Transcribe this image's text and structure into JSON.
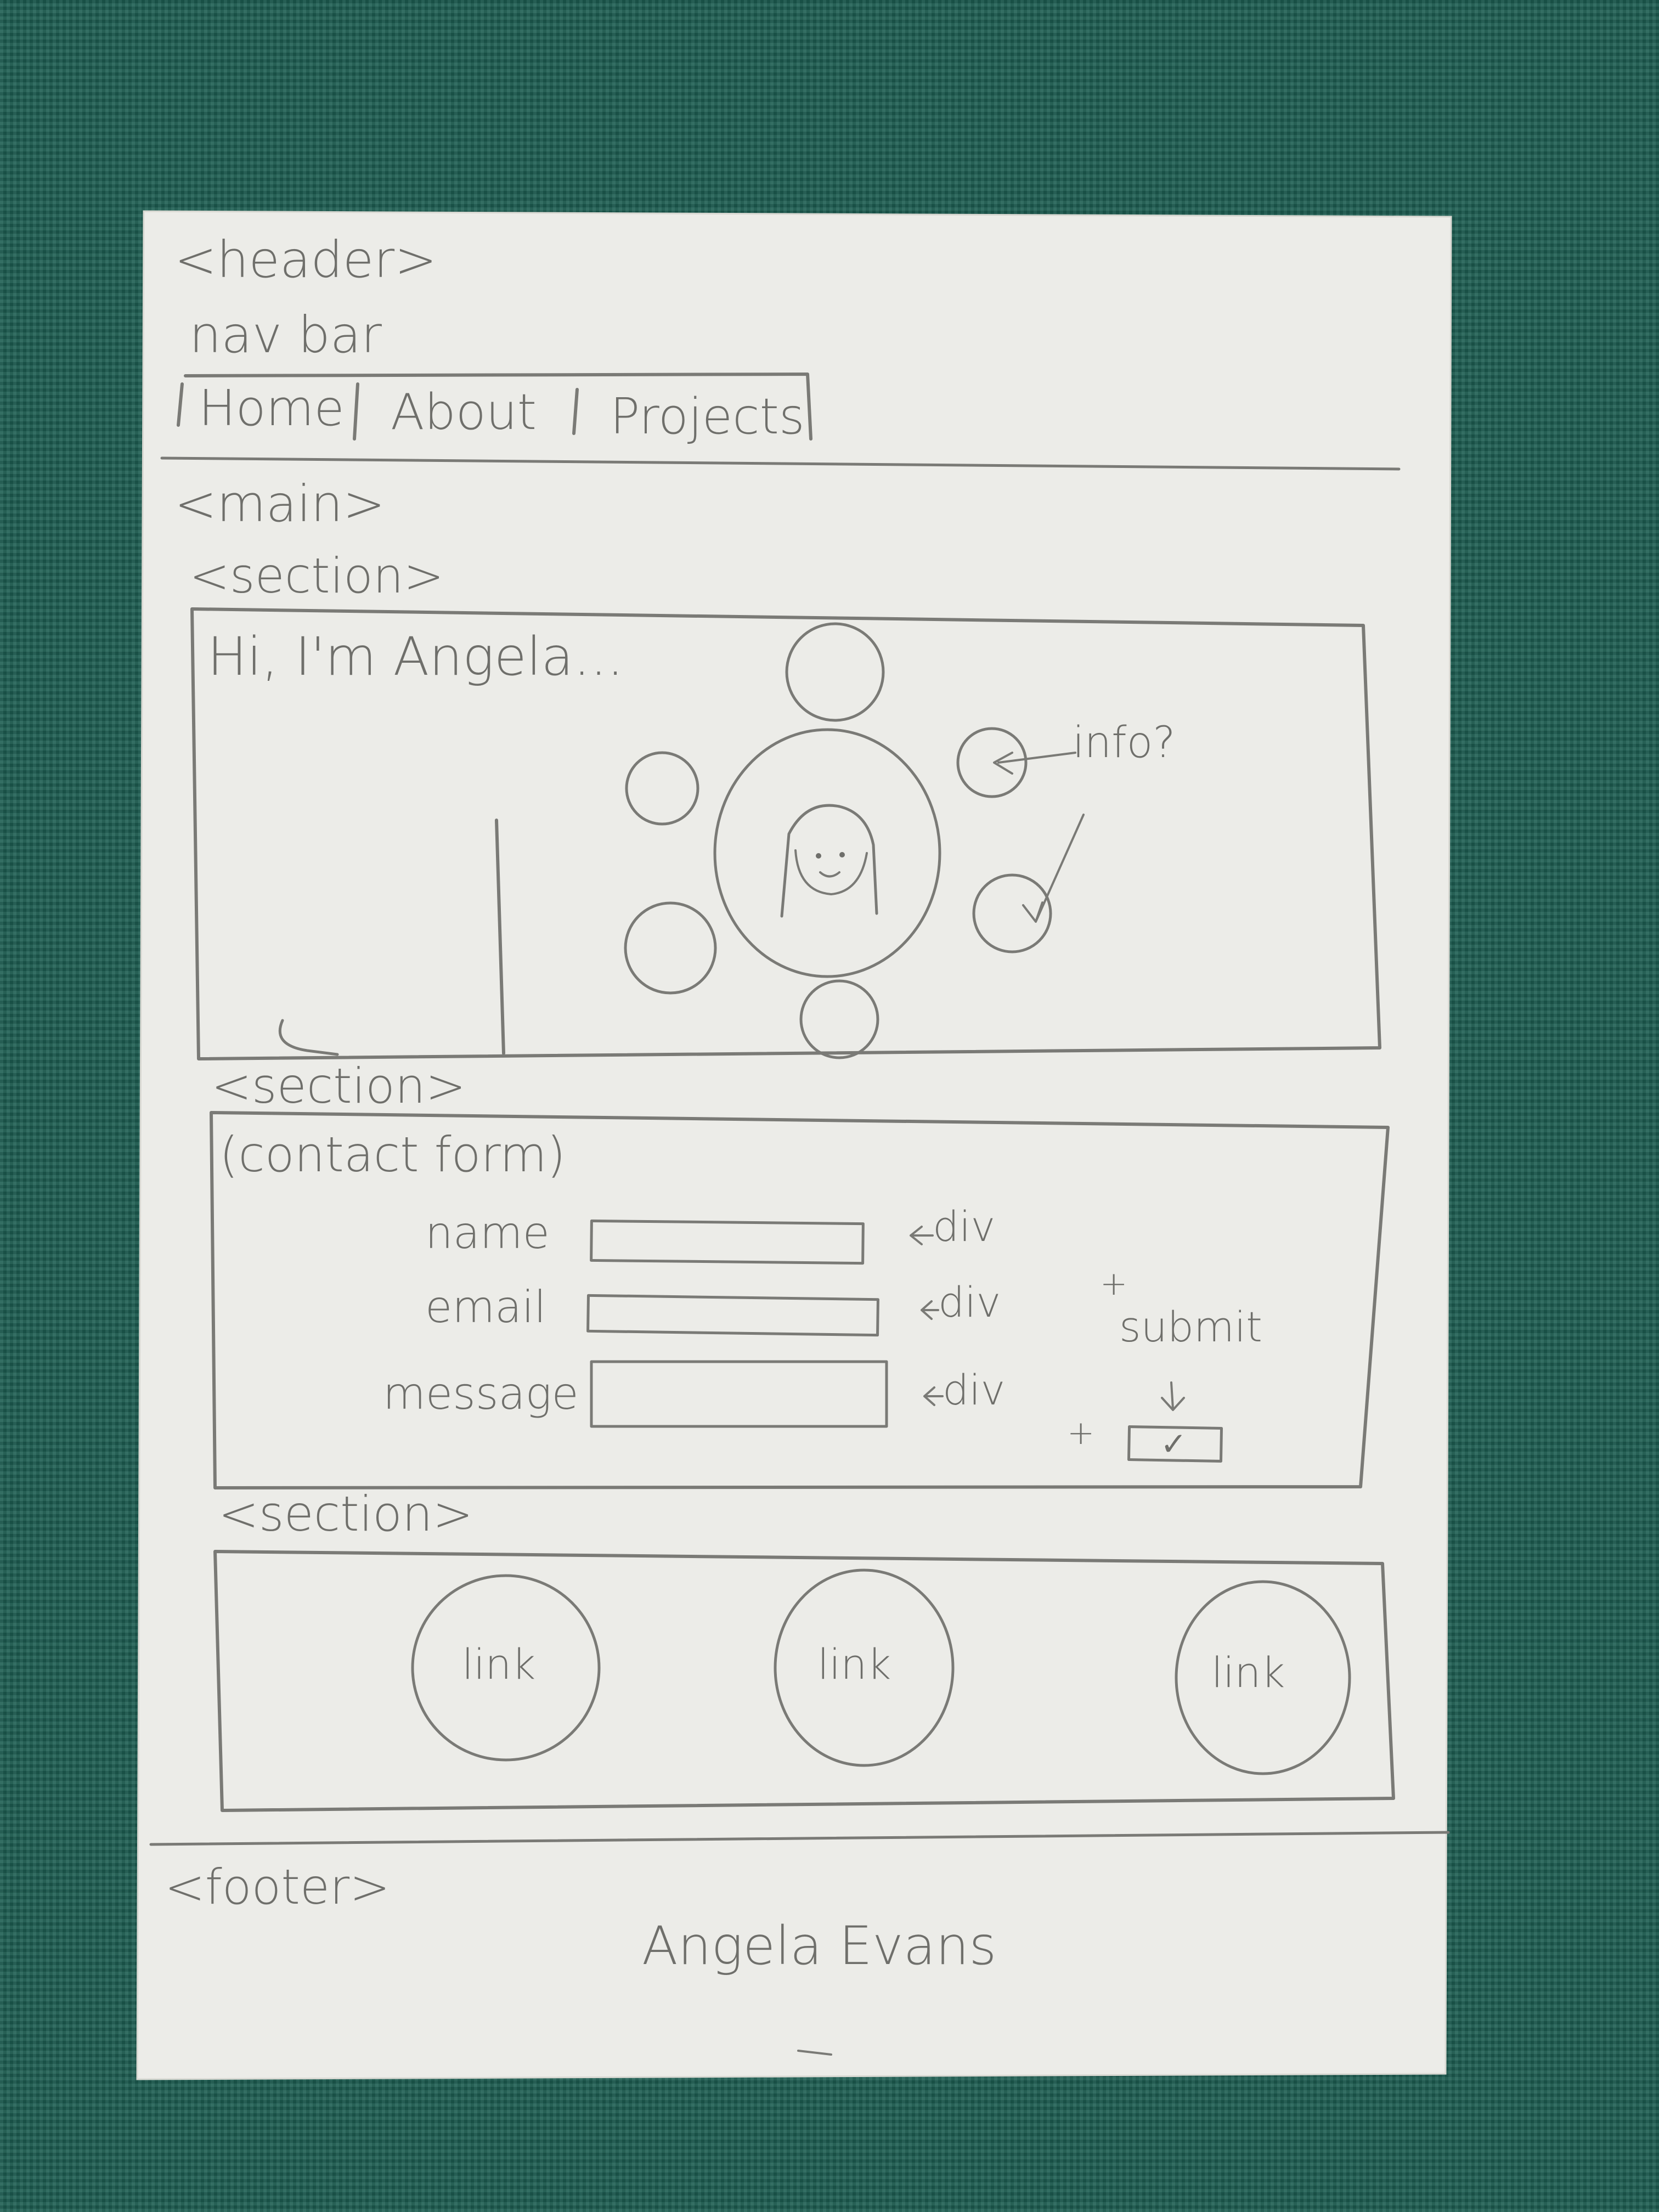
{
  "header": {
    "tag": "<header>",
    "nav_caption": "nav bar",
    "nav_items": [
      "Home",
      "About",
      "Projects"
    ]
  },
  "main": {
    "tag": "<main>",
    "hero_section": {
      "tag": "<section>",
      "greeting": "Hi, I'm Angela...",
      "info_note": "info?"
    },
    "contact_section": {
      "tag": "<section>",
      "caption": "(contact form)",
      "fields": [
        {
          "label": "name",
          "note": "div"
        },
        {
          "label": "email",
          "note": "div"
        },
        {
          "label": "message",
          "note": "div"
        }
      ],
      "plus_mark": "+",
      "submit_label": "submit",
      "submit_check": "✓"
    },
    "links_section": {
      "tag": "<section>",
      "links": [
        "link",
        "link",
        "link"
      ]
    }
  },
  "footer": {
    "tag": "<footer>",
    "name": "Angela Evans"
  }
}
